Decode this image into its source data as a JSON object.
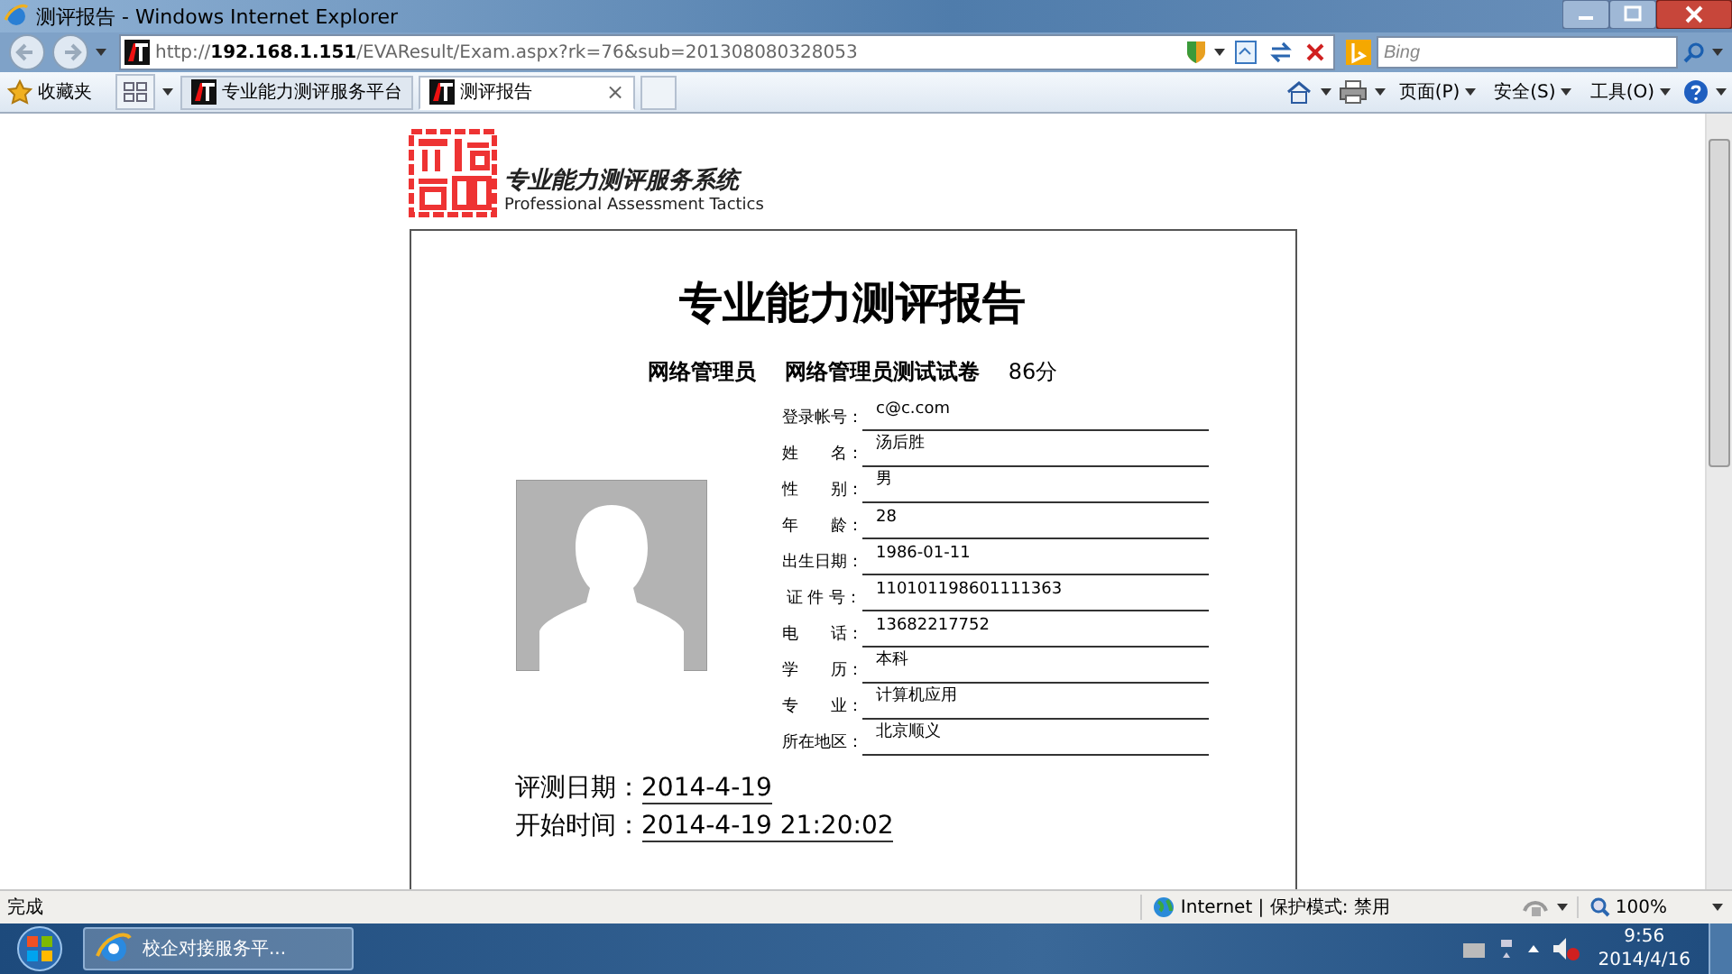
{
  "window": {
    "title": "测评报告 - Windows Internet Explorer"
  },
  "address_bar": {
    "url": "http://**192.168.1.151**/EVAResult/Exam.aspx?rk=76&sub=201308080328053"
  },
  "search": {
    "placeholder": "Bing"
  },
  "favorites": {
    "label": "收藏夹"
  },
  "tabs": [
    {
      "label": "专业能力测评服务平台",
      "selected": false
    },
    {
      "label": "测评报告",
      "selected": true,
      "close": "×"
    }
  ],
  "command_bar": [
    "页面(P)",
    "安全(S)",
    "工具(O)"
  ],
  "page": {
    "logo_title": "专业能力测评服务系统",
    "logo_subtitle": "Professional Assessment Tactics",
    "report_title": "专业能力测评报告",
    "summary": [
      "网络管理员",
      "网络管理员测试试卷",
      "86分"
    ],
    "fields": [
      {
        "label": "登录帐号：",
        "value": "c@c.com"
      },
      {
        "label": "姓　　名：",
        "value": "汤后胜"
      },
      {
        "label": "性　　别：",
        "value": "男"
      },
      {
        "label": "年　　龄：",
        "value": "28"
      },
      {
        "label": "出生日期：",
        "value": "1986-01-11"
      },
      {
        "label": "证 件 号：",
        "value": "110101198601111363"
      },
      {
        "label": "电　　话：",
        "value": "13682217752"
      },
      {
        "label": "学　　历：",
        "value": "本科"
      },
      {
        "label": "专　　业：",
        "value": "计算机应用"
      },
      {
        "label": "所在地区：",
        "value": "北京顺义"
      }
    ],
    "details": [
      {
        "label": "评测日期：",
        "value": "2014-4-19"
      },
      {
        "label": "开始时间：",
        "value": "2014-4-19 21:20:02"
      }
    ]
  },
  "status_bar": {
    "text": "完成",
    "zone": "Internet | 保护模式: 禁用",
    "zoom": "100%"
  },
  "taskbar": {
    "items": [
      {
        "label": "校企对接服务平..."
      }
    ],
    "time": "9:56",
    "date": "2014/4/16"
  }
}
